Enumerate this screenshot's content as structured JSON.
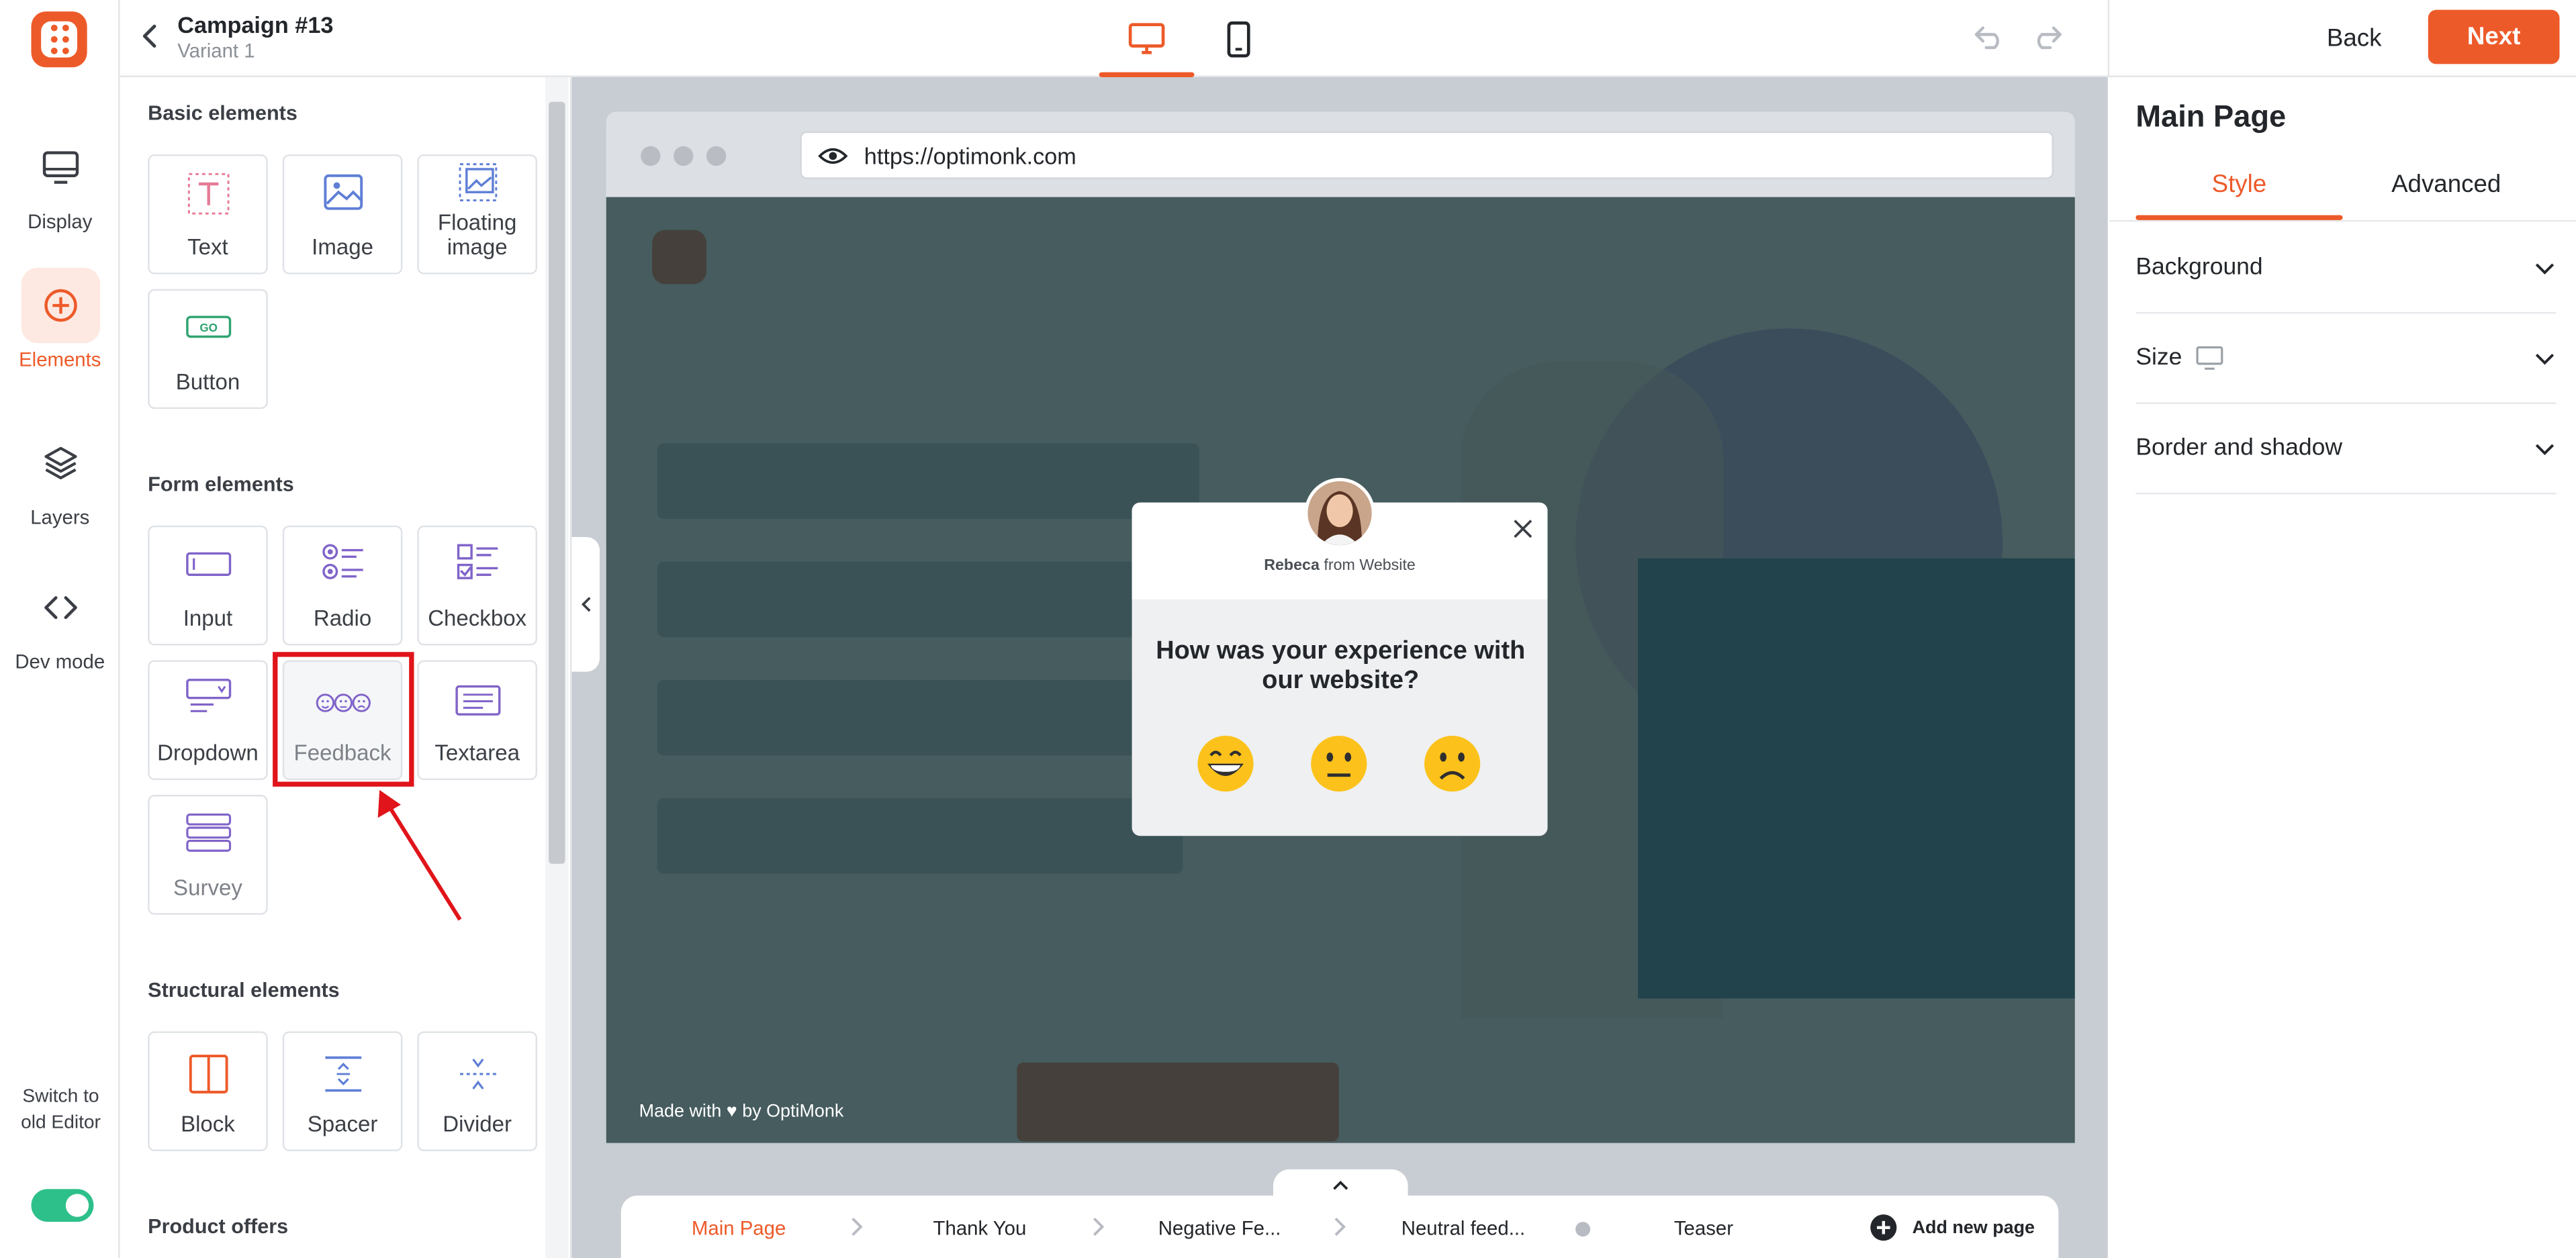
{
  "app": {
    "campaign_title": "Campaign #13",
    "variant": "Variant 1",
    "back_label": "Back",
    "next_label": "Next",
    "accent_color": "#ed5a29"
  },
  "rail": {
    "items": [
      {
        "label": "Display",
        "icon": "monitor-icon"
      },
      {
        "label": "Elements",
        "icon": "plus-circle-icon",
        "active": true
      },
      {
        "label": "Layers",
        "icon": "layers-icon"
      },
      {
        "label": "Dev mode",
        "icon": "code-icon"
      }
    ],
    "switch_label": "Switch to old Editor",
    "switch_on": true
  },
  "panel": {
    "basic_title": "Basic elements",
    "basic": [
      "Text",
      "Image",
      "Floating image",
      "Button"
    ],
    "form_title": "Form elements",
    "form": [
      "Input",
      "Radio",
      "Checkbox",
      "Dropdown",
      "Feedback",
      "Textarea",
      "Survey"
    ],
    "structural_title": "Structural elements",
    "structural": [
      "Block",
      "Spacer",
      "Divider"
    ],
    "product_title": "Product offers"
  },
  "preview": {
    "url": "https://optimonk.com",
    "made_with": "Made with ♥ by OptiMonk",
    "popup": {
      "sender": "Rebeca",
      "sender_suffix": "from Website",
      "question": "How was your experience with our website?",
      "emojis": [
        "very-happy-emoji-icon",
        "neutral-emoji-icon",
        "sad-emoji-icon"
      ]
    }
  },
  "pages": {
    "tabs": [
      "Main Page",
      "Thank You",
      "Negative Fe...",
      "Neutral feed...",
      "Teaser"
    ],
    "add_label": "Add new page"
  },
  "right": {
    "title": "Main Page",
    "tabs": [
      "Style",
      "Advanced"
    ],
    "sections": [
      "Background",
      "Size",
      "Border and shadow"
    ]
  }
}
